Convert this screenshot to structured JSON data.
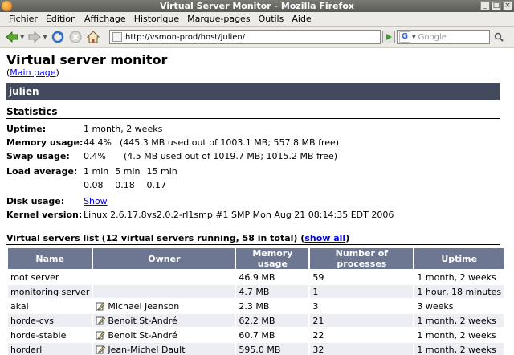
{
  "window": {
    "title": "Virtual Server Monitor - Mozilla Firefox"
  },
  "menu": [
    "Fichier",
    "Édition",
    "Affichage",
    "Historique",
    "Marque-pages",
    "Outils",
    "Aide"
  ],
  "toolbar": {
    "url": "http://vsmon-prod/host/julien/",
    "search_placeholder": "Google"
  },
  "page": {
    "title": "Virtual server monitor",
    "main_link_prefix": "(",
    "main_link": "Main page",
    "main_link_suffix": ")",
    "host": "julien",
    "stats_heading": "Statistics",
    "uptime_label": "Uptime:",
    "uptime": "1 month, 2 weeks",
    "memory_label": "Memory usage:",
    "memory_pct": "44.4%",
    "memory_detail": "(445.3 MB used out of 1003.1 MB; 557.8 MB free)",
    "swap_label": "Swap usage:",
    "swap_pct": "0.4%",
    "swap_detail": "(4.5 MB used out of 1019.7 MB; 1015.2 MB free)",
    "load_label": "Load average:",
    "load_headers": [
      "1 min",
      "5 min",
      "15 min"
    ],
    "load_values": [
      "0.08",
      "0.18",
      "0.17"
    ],
    "disk_label": "Disk usage:",
    "disk_link": "Show",
    "kernel_label": "Kernel version:",
    "kernel": "Linux 2.6.17.8vs2.0.2-rl1smp #1 SMP Mon Aug 21 08:14:35 EDT 2006",
    "vs_heading_prefix": "Virtual servers list (12 virtual servers running, 58 in total) (",
    "vs_show_all": "show all",
    "vs_heading_suffix": ")",
    "table_headers": [
      "Name",
      "Owner",
      "Memory usage",
      "Number of processes",
      "Uptime"
    ],
    "rows": [
      {
        "name": "root server",
        "owner": "",
        "mem": "46.9 MB",
        "procs": "59",
        "uptime": "1 month, 2 weeks"
      },
      {
        "name": "monitoring server",
        "owner": "",
        "mem": "4.7 MB",
        "procs": "1",
        "uptime": "1 hour, 18 minutes"
      },
      {
        "name": "akai",
        "owner": "Michael Jeanson",
        "mem": "2.3 MB",
        "procs": "3",
        "uptime": "3 weeks"
      },
      {
        "name": "horde-cvs",
        "owner": "Benoit St-André",
        "mem": "62.2 MB",
        "procs": "21",
        "uptime": "1 month, 2 weeks"
      },
      {
        "name": "horde-stable",
        "owner": "Benoit St-André",
        "mem": "60.7 MB",
        "procs": "22",
        "uptime": "1 month, 2 weeks"
      },
      {
        "name": "horderl",
        "owner": "Jean-Michel Dault",
        "mem": "595.0 MB",
        "procs": "32",
        "uptime": "1 month, 2 weeks"
      }
    ]
  }
}
